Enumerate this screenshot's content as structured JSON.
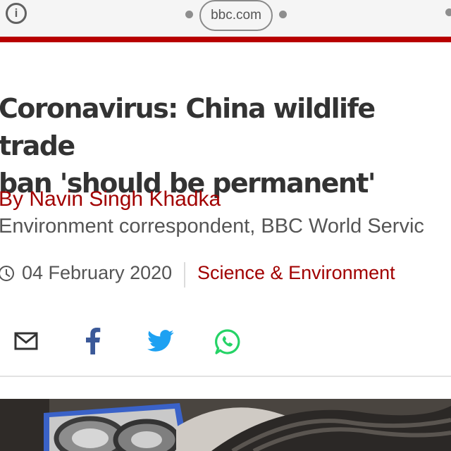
{
  "browser": {
    "url": "bbc.com"
  },
  "article": {
    "headline_line1": "Coronavirus: China wildlife trade",
    "headline_line2": "ban 'should be permanent'",
    "byline": "By Navin Singh Khadka",
    "role": "Environment correspondent, BBC World Servic",
    "date": "04 February 2020",
    "section": "Science & Environment"
  },
  "share": {
    "email_icon": "email-icon",
    "facebook_icon": "facebook-icon",
    "twitter_icon": "twitter-icon",
    "whatsapp_icon": "whatsapp-icon"
  },
  "colors": {
    "accent": "#b80000",
    "link": "#a10000",
    "facebook": "#3b5998",
    "twitter": "#1da1f2",
    "whatsapp": "#25d366"
  }
}
